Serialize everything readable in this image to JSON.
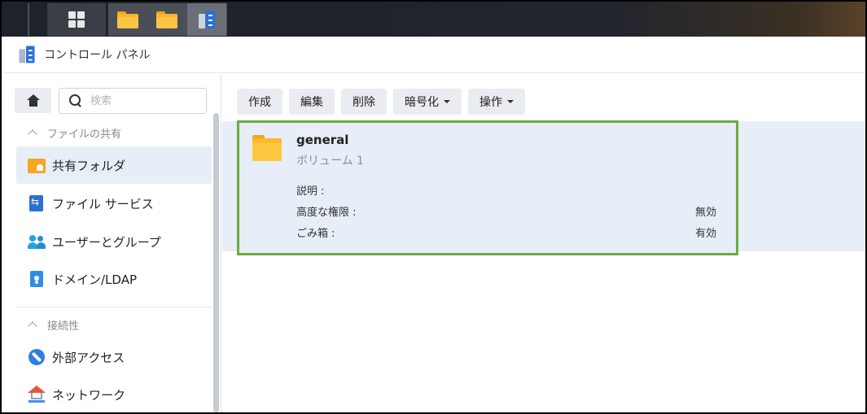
{
  "window": {
    "title": "コントロール パネル"
  },
  "sidebar": {
    "search_placeholder": "検索",
    "sections": [
      {
        "title": "ファイルの共有",
        "items": [
          {
            "label": "共有フォルダ",
            "icon": "shared-folder-icon",
            "active": true
          },
          {
            "label": "ファイル サービス",
            "icon": "file-services-icon"
          },
          {
            "label": "ユーザーとグループ",
            "icon": "user-group-icon"
          },
          {
            "label": "ドメイン/LDAP",
            "icon": "domain-ldap-icon"
          }
        ]
      },
      {
        "title": "接続性",
        "items": [
          {
            "label": "外部アクセス",
            "icon": "external-access-icon"
          },
          {
            "label": "ネットワーク",
            "icon": "network-icon"
          }
        ]
      }
    ]
  },
  "toolbar": {
    "create": "作成",
    "edit": "編集",
    "delete": "削除",
    "encrypt": "暗号化",
    "action": "操作"
  },
  "folder": {
    "name": "general",
    "volume": "ボリューム 1",
    "description_label": "説明 :",
    "description_value": "",
    "advanced_perm_label": "高度な権限 :",
    "advanced_perm_value": "無効",
    "recycle_label": "ごみ箱 :",
    "recycle_value": "有効"
  },
  "colors": {
    "accent_blue": "#2d6fd4",
    "selection_bg": "#e7eef8",
    "highlight_border": "#6bab3f",
    "folder": "#f9b931"
  }
}
